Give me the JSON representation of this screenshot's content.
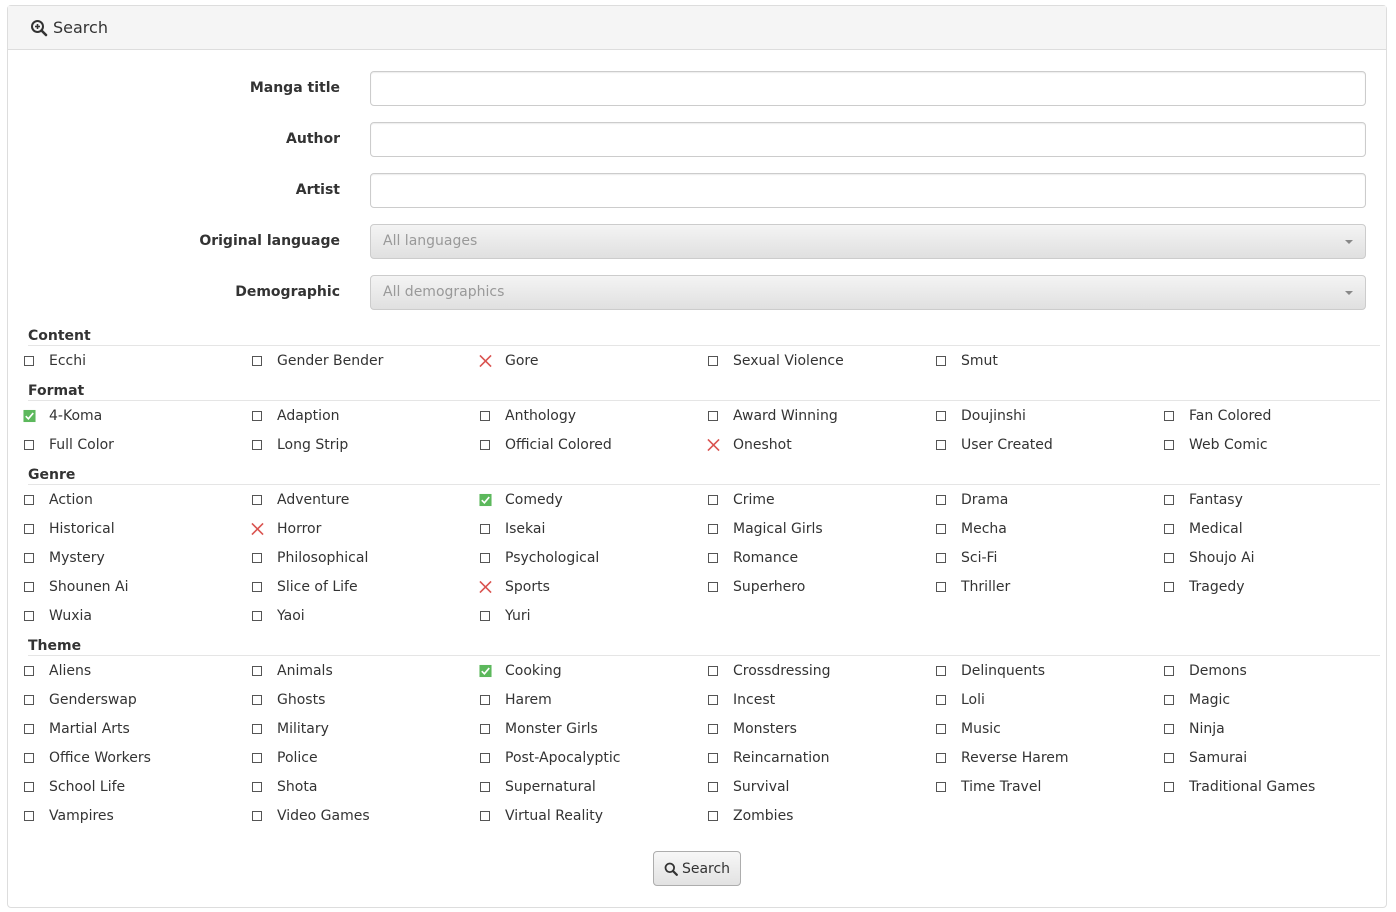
{
  "header": {
    "title": "Search",
    "icon": "search-plus-icon"
  },
  "form": {
    "manga_title": {
      "label": "Manga title",
      "value": ""
    },
    "author": {
      "label": "Author",
      "value": ""
    },
    "artist": {
      "label": "Artist",
      "value": ""
    },
    "original_language": {
      "label": "Original language",
      "selected": "All languages"
    },
    "demographic": {
      "label": "Demographic",
      "selected": "All demographics"
    }
  },
  "colors": {
    "check": "#5cb85c",
    "exclude": "#d9534f"
  },
  "sections": [
    {
      "title": "Content",
      "items": [
        {
          "label": "Ecchi",
          "state": "none"
        },
        {
          "label": "Gender Bender",
          "state": "none"
        },
        {
          "label": "Gore",
          "state": "exclude"
        },
        {
          "label": "Sexual Violence",
          "state": "none"
        },
        {
          "label": "Smut",
          "state": "none"
        }
      ]
    },
    {
      "title": "Format",
      "items": [
        {
          "label": "4-Koma",
          "state": "check"
        },
        {
          "label": "Adaption",
          "state": "none"
        },
        {
          "label": "Anthology",
          "state": "none"
        },
        {
          "label": "Award Winning",
          "state": "none"
        },
        {
          "label": "Doujinshi",
          "state": "none"
        },
        {
          "label": "Fan Colored",
          "state": "none"
        },
        {
          "label": "Full Color",
          "state": "none"
        },
        {
          "label": "Long Strip",
          "state": "none"
        },
        {
          "label": "Official Colored",
          "state": "none"
        },
        {
          "label": "Oneshot",
          "state": "exclude"
        },
        {
          "label": "User Created",
          "state": "none"
        },
        {
          "label": "Web Comic",
          "state": "none"
        }
      ]
    },
    {
      "title": "Genre",
      "items": [
        {
          "label": "Action",
          "state": "none"
        },
        {
          "label": "Adventure",
          "state": "none"
        },
        {
          "label": "Comedy",
          "state": "check"
        },
        {
          "label": "Crime",
          "state": "none"
        },
        {
          "label": "Drama",
          "state": "none"
        },
        {
          "label": "Fantasy",
          "state": "none"
        },
        {
          "label": "Historical",
          "state": "none"
        },
        {
          "label": "Horror",
          "state": "exclude"
        },
        {
          "label": "Isekai",
          "state": "none"
        },
        {
          "label": "Magical Girls",
          "state": "none"
        },
        {
          "label": "Mecha",
          "state": "none"
        },
        {
          "label": "Medical",
          "state": "none"
        },
        {
          "label": "Mystery",
          "state": "none"
        },
        {
          "label": "Philosophical",
          "state": "none"
        },
        {
          "label": "Psychological",
          "state": "none"
        },
        {
          "label": "Romance",
          "state": "none"
        },
        {
          "label": "Sci-Fi",
          "state": "none"
        },
        {
          "label": "Shoujo Ai",
          "state": "none"
        },
        {
          "label": "Shounen Ai",
          "state": "none"
        },
        {
          "label": "Slice of Life",
          "state": "none"
        },
        {
          "label": "Sports",
          "state": "exclude"
        },
        {
          "label": "Superhero",
          "state": "none"
        },
        {
          "label": "Thriller",
          "state": "none"
        },
        {
          "label": "Tragedy",
          "state": "none"
        },
        {
          "label": "Wuxia",
          "state": "none"
        },
        {
          "label": "Yaoi",
          "state": "none"
        },
        {
          "label": "Yuri",
          "state": "none"
        }
      ]
    },
    {
      "title": "Theme",
      "items": [
        {
          "label": "Aliens",
          "state": "none"
        },
        {
          "label": "Animals",
          "state": "none"
        },
        {
          "label": "Cooking",
          "state": "check"
        },
        {
          "label": "Crossdressing",
          "state": "none"
        },
        {
          "label": "Delinquents",
          "state": "none"
        },
        {
          "label": "Demons",
          "state": "none"
        },
        {
          "label": "Genderswap",
          "state": "none"
        },
        {
          "label": "Ghosts",
          "state": "none"
        },
        {
          "label": "Harem",
          "state": "none"
        },
        {
          "label": "Incest",
          "state": "none"
        },
        {
          "label": "Loli",
          "state": "none"
        },
        {
          "label": "Magic",
          "state": "none"
        },
        {
          "label": "Martial Arts",
          "state": "none"
        },
        {
          "label": "Military",
          "state": "none"
        },
        {
          "label": "Monster Girls",
          "state": "none"
        },
        {
          "label": "Monsters",
          "state": "none"
        },
        {
          "label": "Music",
          "state": "none"
        },
        {
          "label": "Ninja",
          "state": "none"
        },
        {
          "label": "Office Workers",
          "state": "none"
        },
        {
          "label": "Police",
          "state": "none"
        },
        {
          "label": "Post-Apocalyptic",
          "state": "none"
        },
        {
          "label": "Reincarnation",
          "state": "none"
        },
        {
          "label": "Reverse Harem",
          "state": "none"
        },
        {
          "label": "Samurai",
          "state": "none"
        },
        {
          "label": "School Life",
          "state": "none"
        },
        {
          "label": "Shota",
          "state": "none"
        },
        {
          "label": "Supernatural",
          "state": "none"
        },
        {
          "label": "Survival",
          "state": "none"
        },
        {
          "label": "Time Travel",
          "state": "none"
        },
        {
          "label": "Traditional Games",
          "state": "none"
        },
        {
          "label": "Vampires",
          "state": "none"
        },
        {
          "label": "Video Games",
          "state": "none"
        },
        {
          "label": "Virtual Reality",
          "state": "none"
        },
        {
          "label": "Zombies",
          "state": "none"
        }
      ]
    }
  ],
  "submit": {
    "label": "Search",
    "icon": "search-icon"
  }
}
